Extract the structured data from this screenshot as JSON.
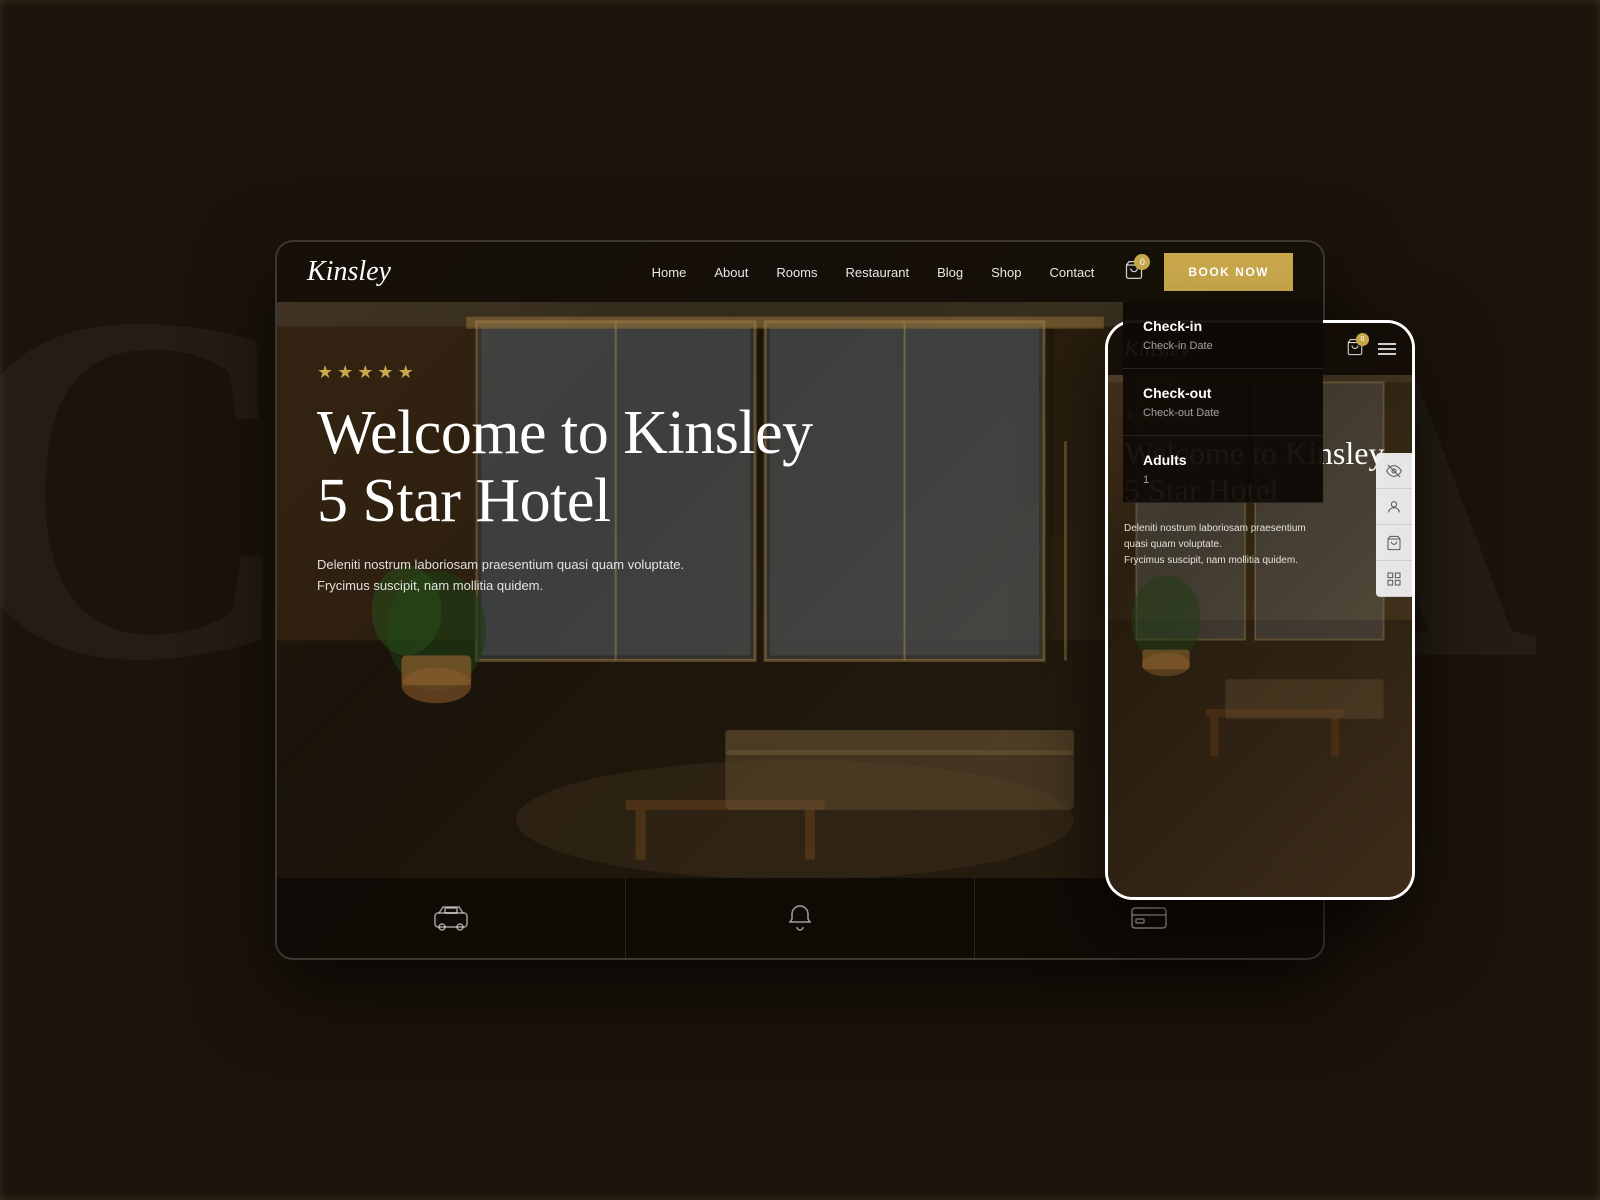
{
  "background": {
    "color": "#2a1f12",
    "letter_left": "C",
    "letter_right": "A"
  },
  "desktop": {
    "nav": {
      "logo": "Kinsley",
      "links": [
        "Home",
        "About",
        "Rooms",
        "Restaurant",
        "Blog",
        "Shop",
        "Contact"
      ],
      "cart_badge": "0",
      "book_button": "BOOK NOW"
    },
    "hero": {
      "stars": [
        "★",
        "★",
        "★",
        "★",
        "★"
      ],
      "title": "Welcome to Kinsley\n5 Star Hotel",
      "subtitle_line1": "Deleniti nostrum laboriosam praesentium quasi quam voluptate.",
      "subtitle_line2": "Frycimus suscipit, nam mollitia quidem."
    },
    "booking_dropdown": {
      "checkin_label": "Check-in",
      "checkin_value": "Check-in Date",
      "checkout_label": "Check-out",
      "checkout_value": "Check-out Date",
      "adults_label": "Adults",
      "adults_value": "1"
    }
  },
  "mobile": {
    "nav": {
      "logo": "Kinsley",
      "cart_badge": "0"
    },
    "hero": {
      "stars": [
        "★",
        "★",
        "★",
        "★",
        "★"
      ],
      "title": "Welcome to Kinsley\n5 Star Hotel",
      "subtitle_line1": "Deleniti nostrum laboriosam praesentium",
      "subtitle_line2": "quasi quam voluptate.",
      "subtitle_line3": "Frycimus suscipit, nam mollitia quidem."
    }
  },
  "icons": {
    "cart": "🛒",
    "menu": "☰",
    "eye": "👁",
    "user": "👤",
    "cart2": "🛒",
    "grid": "⊞",
    "taxi": "🚕",
    "bell": "🔔",
    "card": "💳"
  },
  "colors": {
    "gold": "#c9a84c",
    "dark_bg": "#1a140d",
    "nav_bg": "rgba(15,10,5,0.9)",
    "text_light": "rgba(255,255,255,0.85)"
  }
}
